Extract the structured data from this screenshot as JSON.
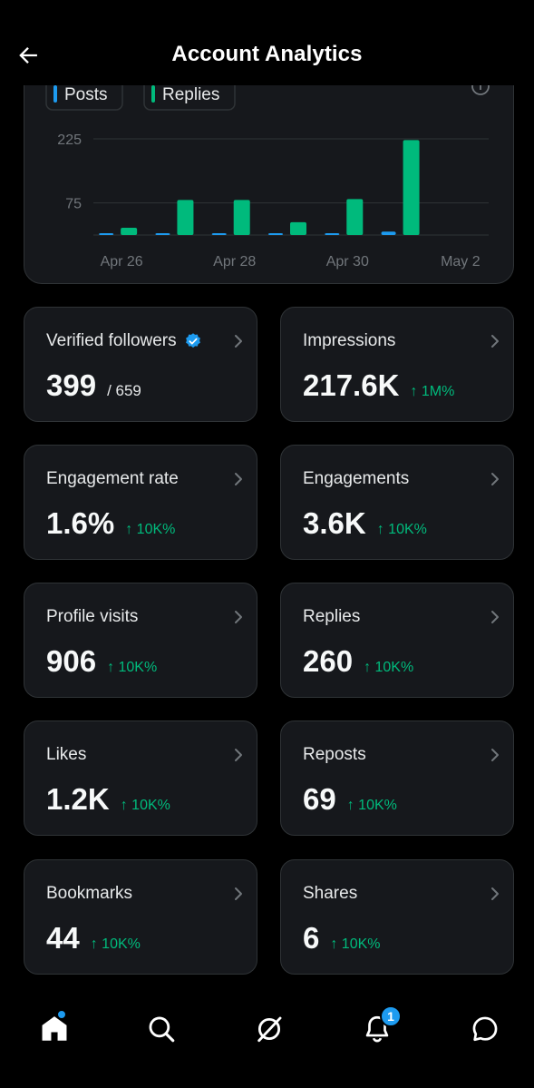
{
  "header": {
    "title": "Account Analytics"
  },
  "chart_data": {
    "type": "bar",
    "categories": [
      "Apr 26",
      "Apr 27",
      "Apr 28",
      "Apr 29",
      "Apr 30",
      "May 1",
      "May 2"
    ],
    "x_tick_labels": [
      "Apr 26",
      "Apr 28",
      "Apr 30",
      "May 2"
    ],
    "y_ticks": [
      75,
      225
    ],
    "series": [
      {
        "name": "Posts",
        "color": "#1d9bf0",
        "values": [
          3,
          3,
          3,
          1,
          1,
          8,
          0
        ]
      },
      {
        "name": "Replies",
        "color": "#00ba7c",
        "values": [
          17,
          82,
          82,
          30,
          84,
          222,
          0
        ]
      }
    ],
    "ylim": [
      0,
      225
    ],
    "legend_placement": "top-left",
    "grid": true
  },
  "stats": [
    {
      "label": "Verified followers",
      "value": "399",
      "sub": "/ 659",
      "change": "",
      "verified": true
    },
    {
      "label": "Impressions",
      "value": "217.6K",
      "sub": "",
      "change": "↑ 1M%"
    },
    {
      "label": "Engagement rate",
      "value": "1.6%",
      "sub": "",
      "change": "↑ 10K%"
    },
    {
      "label": "Engagements",
      "value": "3.6K",
      "sub": "",
      "change": "↑ 10K%"
    },
    {
      "label": "Profile visits",
      "value": "906",
      "sub": "",
      "change": "↑ 10K%"
    },
    {
      "label": "Replies",
      "value": "260",
      "sub": "",
      "change": "↑ 10K%"
    },
    {
      "label": "Likes",
      "value": "1.2K",
      "sub": "",
      "change": "↑ 10K%"
    },
    {
      "label": "Reposts",
      "value": "69",
      "sub": "",
      "change": "↑ 10K%"
    },
    {
      "label": "Bookmarks",
      "value": "44",
      "sub": "",
      "change": "↑ 10K%"
    },
    {
      "label": "Shares",
      "value": "6",
      "sub": "",
      "change": "↑ 10K%"
    }
  ],
  "nav": {
    "items": [
      "home-icon",
      "search-icon",
      "grok-icon",
      "notifications-icon",
      "messages-icon"
    ],
    "notification_count": "1"
  },
  "colors": {
    "accent": "#1d9bf0",
    "positive": "#00ba7c",
    "card": "#16181c",
    "border": "#2f3336"
  }
}
